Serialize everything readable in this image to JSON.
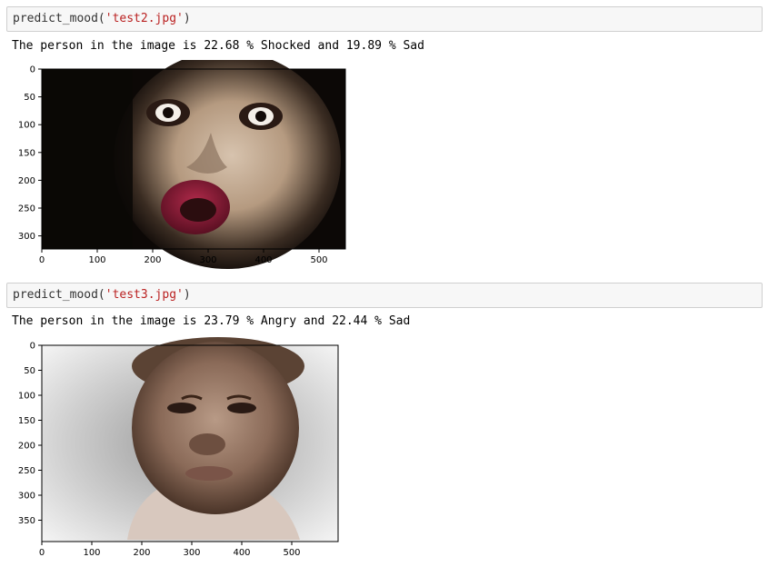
{
  "cells": [
    {
      "code": {
        "function": "predict_mood",
        "open": "(",
        "argument": "'test2.jpg'",
        "close": ")"
      },
      "output": "The person in the image is 22.68 % Shocked and 19.89 % Sad",
      "plot": {
        "x_ticks": [
          "0",
          "100",
          "200",
          "300",
          "400",
          "500"
        ],
        "y_ticks": [
          "0",
          "50",
          "100",
          "150",
          "200",
          "250",
          "300"
        ],
        "image_description": "woman with wide shocked eyes and open red lips"
      }
    },
    {
      "code": {
        "function": "predict_mood",
        "open": "(",
        "argument": "'test3.jpg'",
        "close": ")"
      },
      "output": "The person in the image is 23.79 % Angry and 22.44 % Sad",
      "plot": {
        "x_ticks": [
          "0",
          "100",
          "200",
          "300",
          "400",
          "500"
        ],
        "y_ticks": [
          "0",
          "50",
          "100",
          "150",
          "200",
          "250",
          "300",
          "350"
        ],
        "image_description": "young boy with a frowning face"
      }
    }
  ],
  "colors": {
    "string": "#ba2121",
    "input_bg": "#f7f7f7",
    "input_border": "#cfcfcf"
  }
}
